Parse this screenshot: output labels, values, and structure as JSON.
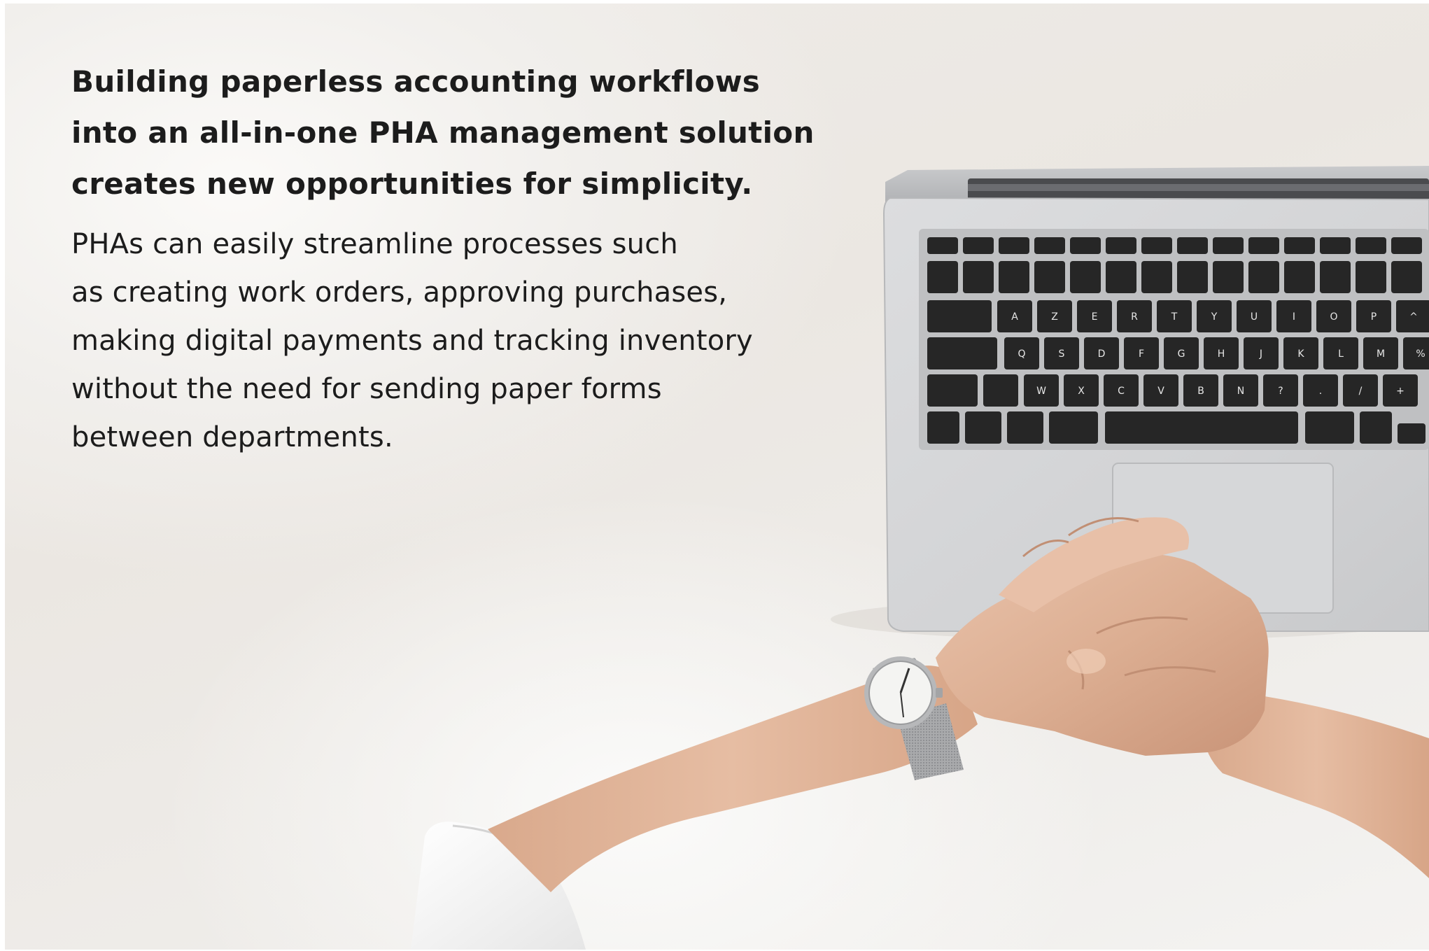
{
  "headline_lines": [
    "Building paperless accounting workflows",
    "into an all-in-one PHA management solution",
    "creates new opportunities for simplicity."
  ],
  "body_lines": [
    "PHAs can easily streamline processes such",
    "as creating work orders, approving purchases,",
    "making digital payments and tracking inventory",
    "without the need for sending paper forms",
    "between departments."
  ],
  "photo": {
    "subject": "overhead view of clasped hands wearing a wristwatch resting beside an open laptop on a white desk",
    "icons": [
      "laptop-icon",
      "keyboard-icon",
      "trackpad-icon",
      "wristwatch-icon",
      "hands-icon",
      "sleeve-icon"
    ],
    "colors": {
      "desk": "#eeebe7",
      "laptop_body": "#d3d4d6",
      "keys": "#262626",
      "skin": "#e2b69c",
      "sleeve": "#fafafa",
      "watch_band": "#a5a6a8"
    }
  },
  "keyboard": {
    "row1": [
      "A",
      "Z",
      "E",
      "R",
      "T",
      "Y",
      "U",
      "I",
      "O",
      "P",
      "^"
    ],
    "row2": [
      "Q",
      "S",
      "D",
      "F",
      "G",
      "H",
      "J",
      "K",
      "L",
      "M",
      "%"
    ],
    "row3": [
      "W",
      "X",
      "C",
      "V",
      "B",
      "N",
      "?",
      ".",
      "/",
      "+"
    ]
  }
}
